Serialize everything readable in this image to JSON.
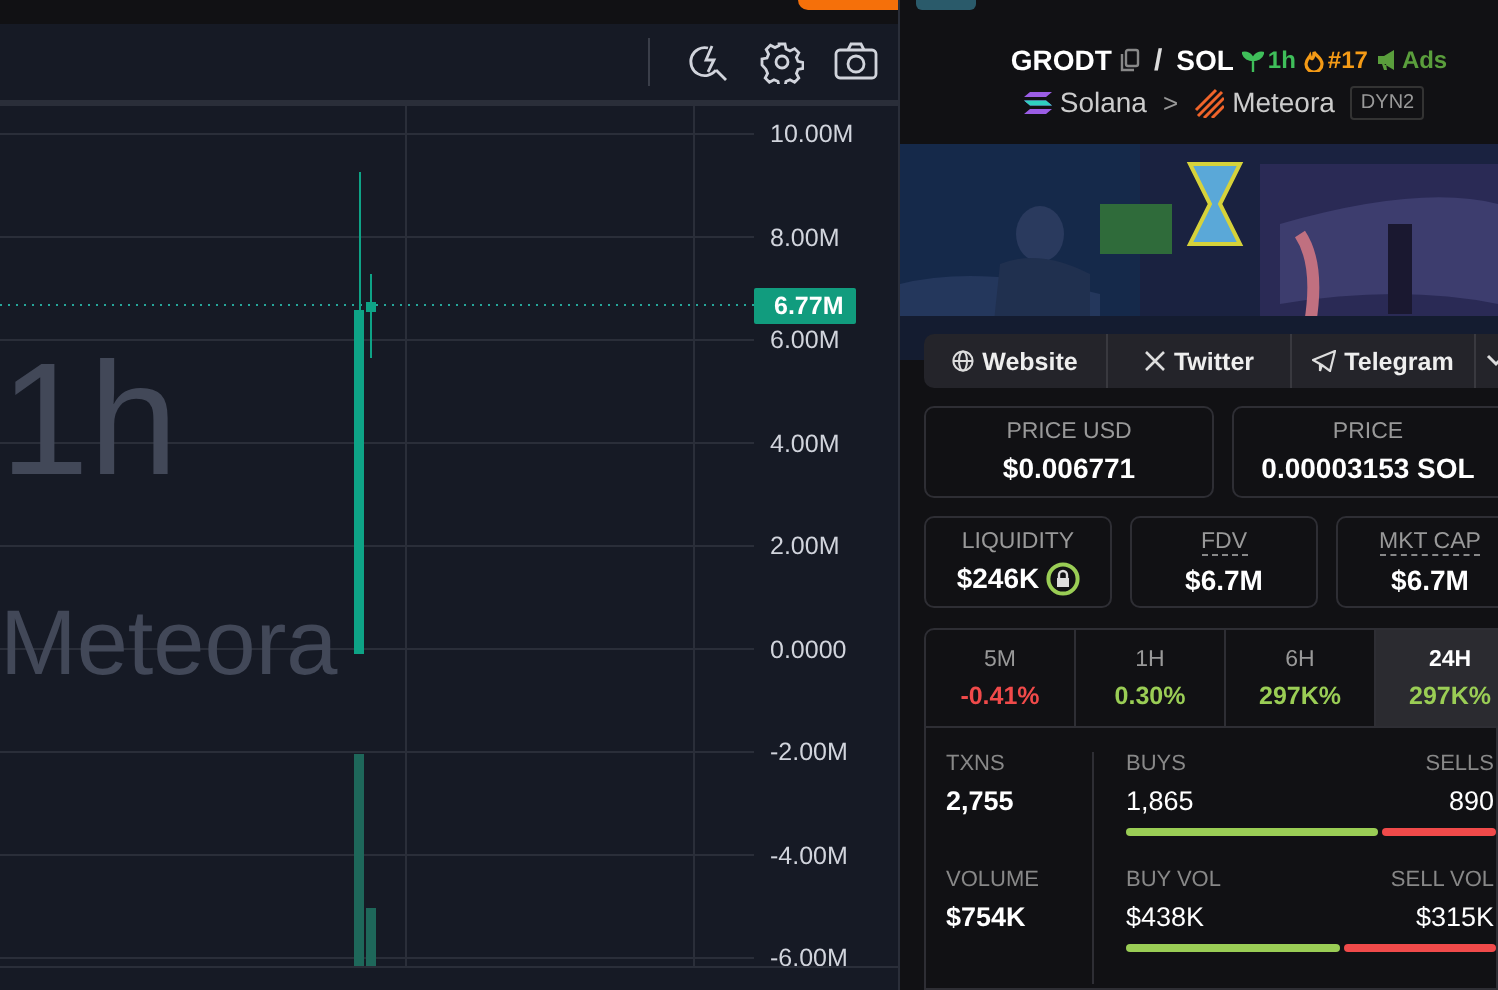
{
  "chart": {
    "y_labels": [
      "10.00M",
      "8.00M",
      "6.00M",
      "4.00M",
      "2.00M",
      "0.0000",
      "-2.00M",
      "-4.00M",
      "-6.00M"
    ],
    "price_tag": "6.77M",
    "watermark": [
      "1h",
      "Meteora"
    ]
  },
  "pair": {
    "base": "GRODT",
    "separator": "/",
    "quote": "SOL",
    "age": "1h",
    "rank": "#17",
    "ads": "Ads"
  },
  "route": {
    "chain": "Solana",
    "separator": ">",
    "dex": "Meteora",
    "pool": "DYN2"
  },
  "links": [
    {
      "label": "Website",
      "kind": "globe"
    },
    {
      "label": "Twitter",
      "kind": "x"
    },
    {
      "label": "Telegram",
      "kind": "telegram"
    }
  ],
  "prices": [
    {
      "label": "PRICE USD",
      "value": "$0.006771"
    },
    {
      "label": "PRICE",
      "value": "0.00003153 SOL"
    }
  ],
  "metrics": [
    {
      "label": "LIQUIDITY",
      "value": "$246K",
      "locked": true,
      "dotted": false
    },
    {
      "label": "FDV",
      "value": "$6.7M",
      "locked": false,
      "dotted": true
    },
    {
      "label": "MKT CAP",
      "value": "$6.7M",
      "locked": false,
      "dotted": true
    }
  ],
  "periods": [
    {
      "label": "5M",
      "change": "-0.41%",
      "color": "#f04a4a",
      "selected": false
    },
    {
      "label": "1H",
      "change": "0.30%",
      "color": "#9acd55",
      "selected": false
    },
    {
      "label": "6H",
      "change": "297K%",
      "color": "#9acd55",
      "selected": false
    },
    {
      "label": "24H",
      "change": "297K%",
      "color": "#9acd55",
      "selected": true
    }
  ],
  "stats": [
    {
      "label": "TXNS",
      "value": "2,755",
      "buy_label": "BUYS",
      "buy": "1,865",
      "sell_label": "SELLS",
      "sell": "890",
      "level": 0.68
    },
    {
      "label": "VOLUME",
      "value": "$754K",
      "buy_label": "BUY VOL",
      "buy": "$438K",
      "sell_label": "SELL VOL",
      "sell": "$315K",
      "level": 0.58
    }
  ]
}
